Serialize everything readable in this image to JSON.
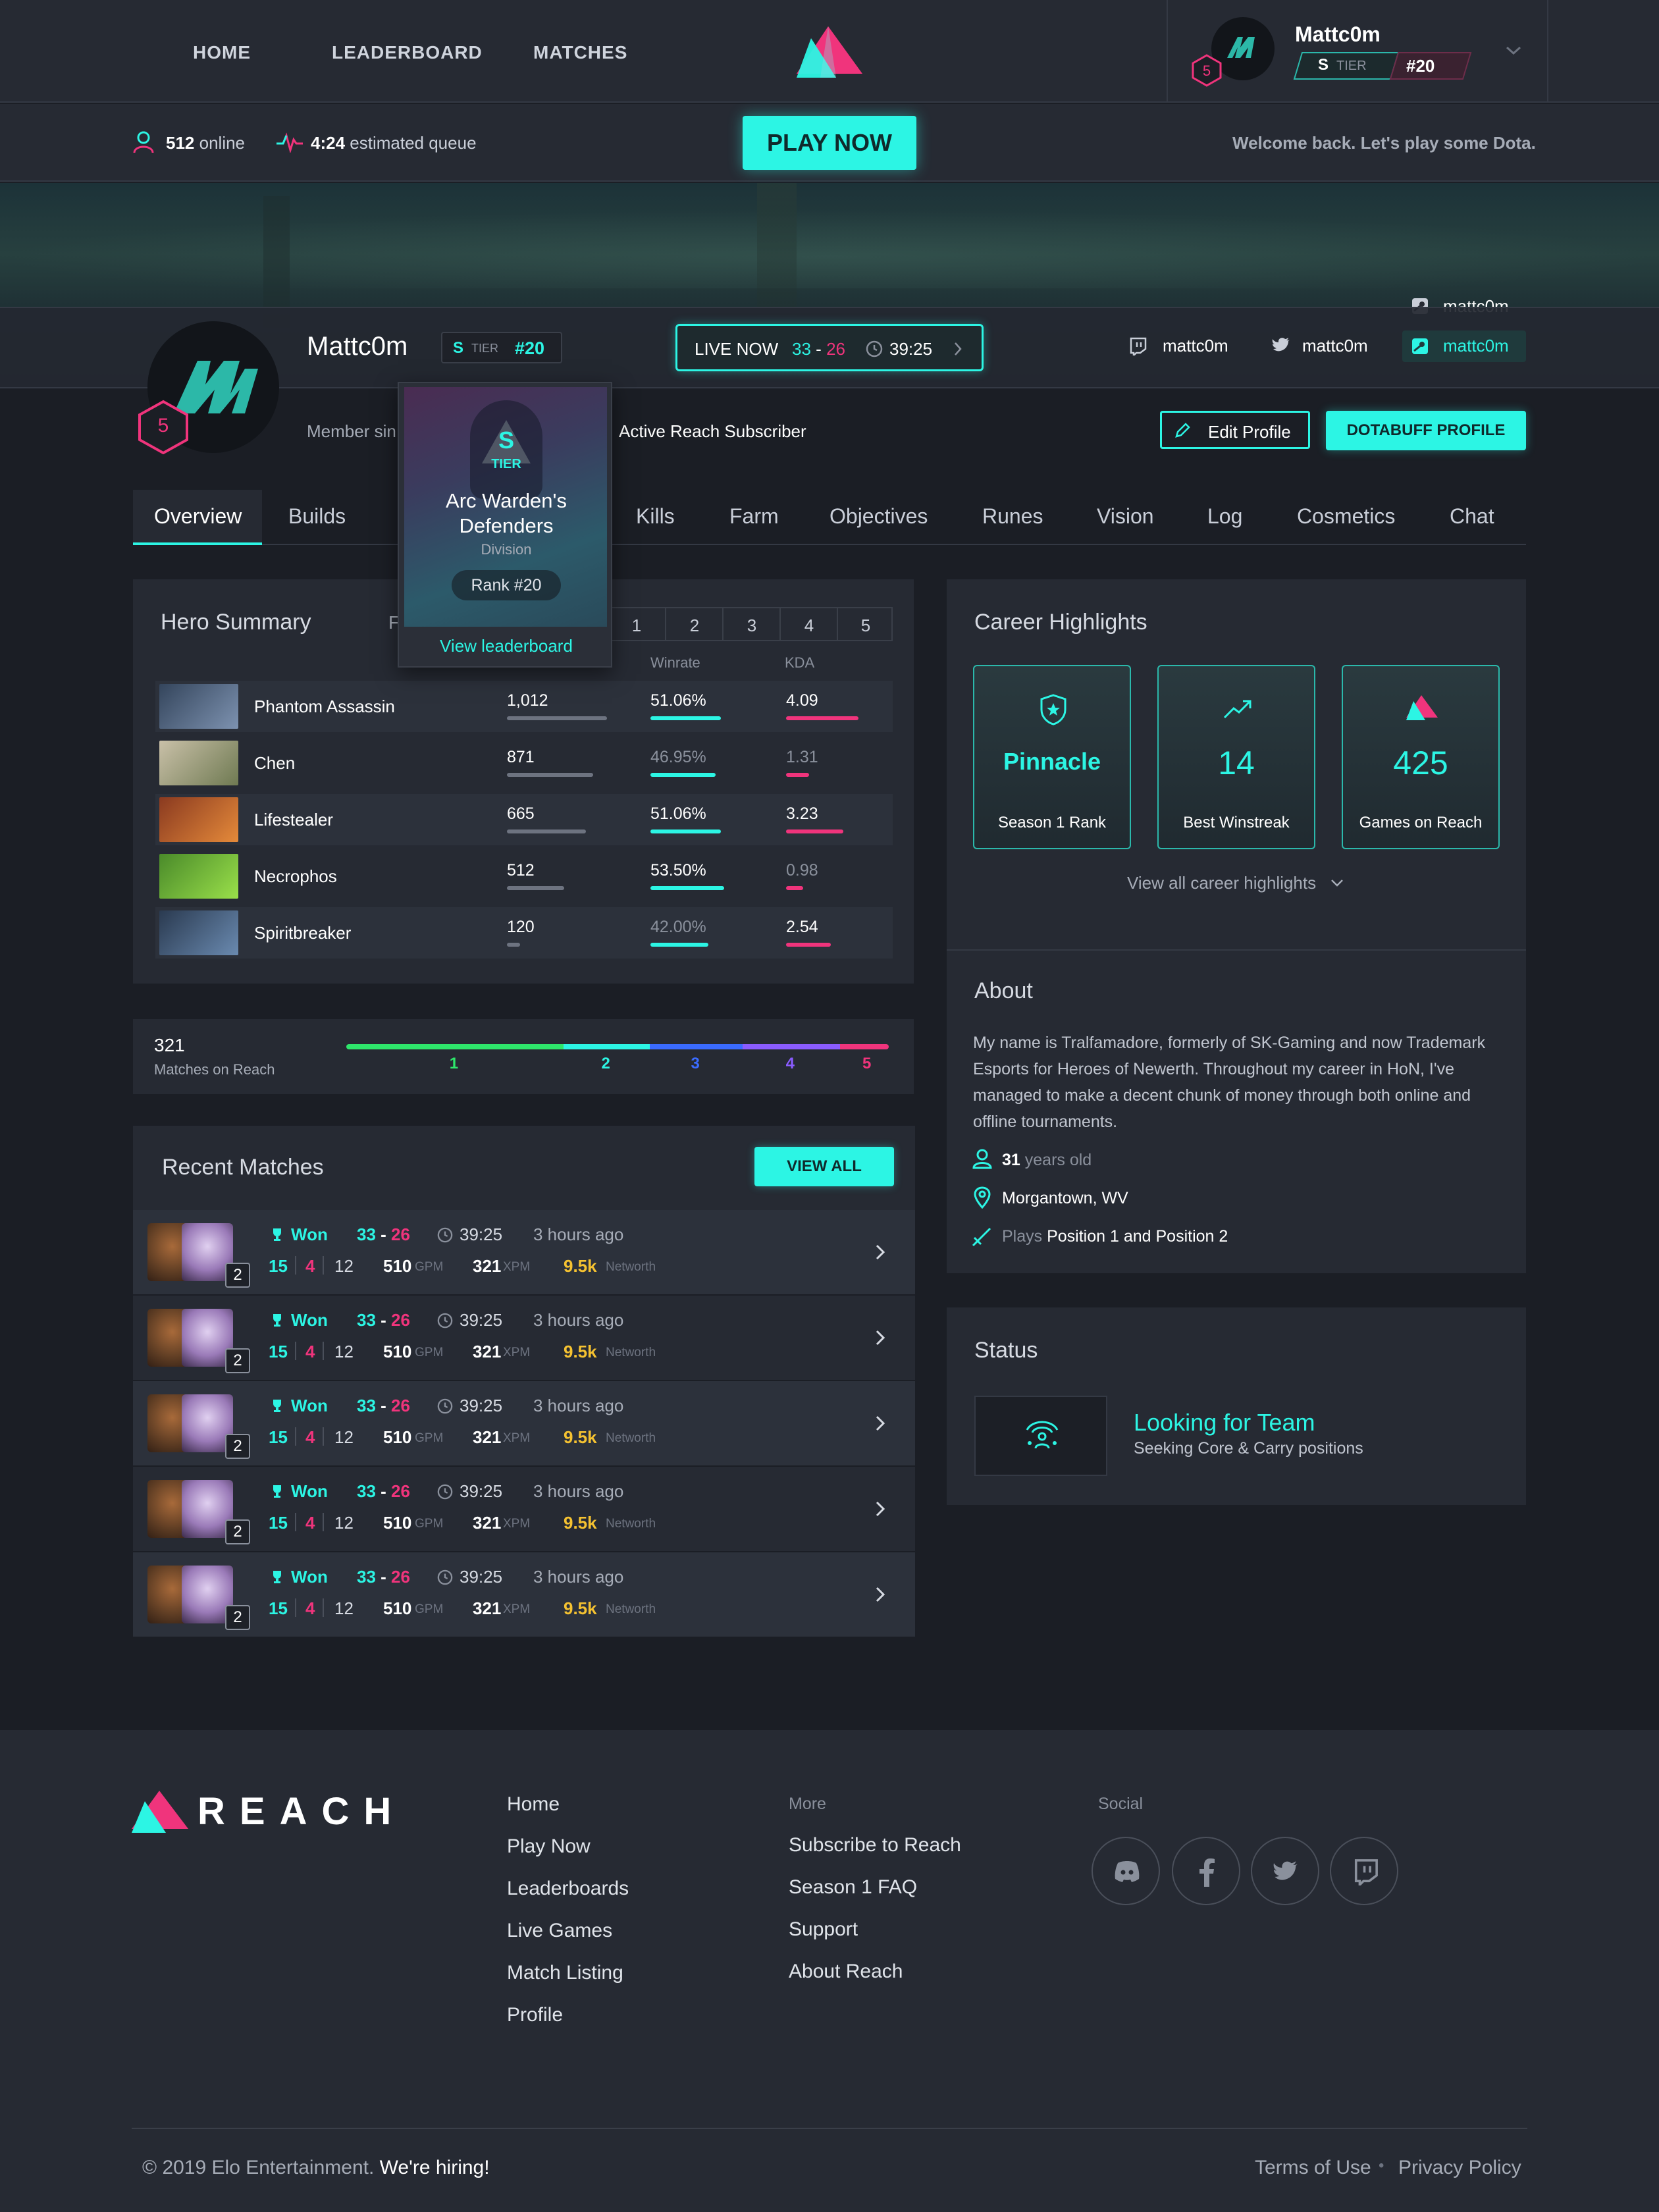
{
  "nav": {
    "home": "HOME",
    "leaderboard": "LEADERBOARD",
    "matches": "MATCHES"
  },
  "user": {
    "name": "Mattc0m",
    "tier_letter": "S",
    "tier_label": "TIER",
    "rank": "#20",
    "level": "5"
  },
  "subbar": {
    "online_count": "512",
    "online_label": "online",
    "queue_time": "4:24",
    "queue_label": "estimated queue",
    "play_now": "PLAY NOW",
    "welcome": "Welcome back. Let's play some Dota."
  },
  "profile": {
    "name": "Mattc0m",
    "tier_letter": "S",
    "tier_label": "TIER",
    "rank": "#20",
    "level": "5",
    "live": {
      "label": "LIVE NOW",
      "score_a": "33",
      "dash": "-",
      "score_b": "26",
      "time": "39:25"
    },
    "social": {
      "twitch": "mattc0m",
      "twitter": "mattc0m",
      "steam": "mattc0m",
      "steam_top": "mattc0m"
    },
    "member_since": "Member sin",
    "subscriber": "Active Reach Subscriber",
    "edit_profile": "Edit Profile",
    "dotabuff": "DOTABUFF PROFILE"
  },
  "tooltip": {
    "tier_letter": "S",
    "tier_label": "TIER",
    "team": "Arc Warden's Defenders",
    "division": "Division",
    "rank": "Rank #20",
    "link": "View leaderboard"
  },
  "tabs": [
    "Overview",
    "Builds",
    "Kills",
    "Farm",
    "Objectives",
    "Runes",
    "Vision",
    "Log",
    "Cosmetics",
    "Chat"
  ],
  "hero_summary": {
    "title": "Hero Summary",
    "filter_prefix": "F",
    "positions": [
      "1",
      "2",
      "3",
      "4",
      "5"
    ],
    "col_winrate": "Winrate",
    "col_kda": "KDA",
    "rows": [
      {
        "name": "Phantom Assassin",
        "matches": "1,012",
        "matches_frac": 1.0,
        "winrate": "51.06%",
        "win_frac": 0.51,
        "win_hi": true,
        "kda": "4.09",
        "kda_frac": 1.0,
        "kda_hi": true
      },
      {
        "name": "Chen",
        "matches": "871",
        "matches_frac": 0.86,
        "winrate": "46.95%",
        "win_frac": 0.47,
        "win_hi": false,
        "kda": "1.31",
        "kda_frac": 0.32,
        "kda_hi": false
      },
      {
        "name": "Lifestealer",
        "matches": "665",
        "matches_frac": 0.79,
        "winrate": "51.06%",
        "win_frac": 0.51,
        "win_hi": true,
        "kda": "3.23",
        "kda_frac": 0.79,
        "kda_hi": true
      },
      {
        "name": "Necrophos",
        "matches": "512",
        "matches_frac": 0.57,
        "winrate": "53.50%",
        "win_frac": 0.535,
        "win_hi": true,
        "kda": "0.98",
        "kda_frac": 0.24,
        "kda_hi": false
      },
      {
        "name": "Spiritbreaker",
        "matches": "120",
        "matches_frac": 0.13,
        "winrate": "42.00%",
        "win_frac": 0.42,
        "win_hi": false,
        "kda": "2.54",
        "kda_frac": 0.62,
        "kda_hi": true
      }
    ]
  },
  "matches_on_reach": {
    "count": "321",
    "label": "Matches on Reach",
    "positions": [
      "1",
      "2",
      "3",
      "4",
      "5"
    ],
    "position_share": [
      0.4,
      0.16,
      0.17,
      0.18,
      0.09
    ],
    "colors": [
      "#2ee66b",
      "#2cf5e4",
      "#3a6bff",
      "#8a5cff",
      "#f0347c"
    ]
  },
  "recent_matches": {
    "title": "Recent Matches",
    "view_all": "VIEW ALL",
    "rows": [
      {
        "badge": "2",
        "result": "Won",
        "score_a": "33",
        "score_b": "26",
        "time": "39:25",
        "ago": "3 hours ago",
        "k": "15",
        "d": "4",
        "a": "12",
        "gpm": "510",
        "gpm_label": "GPM",
        "xpm": "321",
        "xpm_label": "XPM",
        "networth": "9.5k",
        "networth_label": "Networth"
      },
      {
        "badge": "2",
        "result": "Won",
        "score_a": "33",
        "score_b": "26",
        "time": "39:25",
        "ago": "3 hours ago",
        "k": "15",
        "d": "4",
        "a": "12",
        "gpm": "510",
        "gpm_label": "GPM",
        "xpm": "321",
        "xpm_label": "XPM",
        "networth": "9.5k",
        "networth_label": "Networth"
      },
      {
        "badge": "2",
        "result": "Won",
        "score_a": "33",
        "score_b": "26",
        "time": "39:25",
        "ago": "3 hours ago",
        "k": "15",
        "d": "4",
        "a": "12",
        "gpm": "510",
        "gpm_label": "GPM",
        "xpm": "321",
        "xpm_label": "XPM",
        "networth": "9.5k",
        "networth_label": "Networth"
      },
      {
        "badge": "2",
        "result": "Won",
        "score_a": "33",
        "score_b": "26",
        "time": "39:25",
        "ago": "3 hours ago",
        "k": "15",
        "d": "4",
        "a": "12",
        "gpm": "510",
        "gpm_label": "GPM",
        "xpm": "321",
        "xpm_label": "XPM",
        "networth": "9.5k",
        "networth_label": "Networth"
      },
      {
        "badge": "2",
        "result": "Won",
        "score_a": "33",
        "score_b": "26",
        "time": "39:25",
        "ago": "3 hours ago",
        "k": "15",
        "d": "4",
        "a": "12",
        "gpm": "510",
        "gpm_label": "GPM",
        "xpm": "321",
        "xpm_label": "XPM",
        "networth": "9.5k",
        "networth_label": "Networth"
      }
    ]
  },
  "career": {
    "title": "Career Highlights",
    "cards": [
      {
        "value": "Pinnacle",
        "label": "Season 1 Rank",
        "icon": "shield-star-icon"
      },
      {
        "value": "14",
        "label": "Best Winstreak",
        "icon": "trend-up-icon"
      },
      {
        "value": "425",
        "label": "Games on Reach",
        "icon": "reach-logo-icon"
      }
    ],
    "view_all": "View all career highlights"
  },
  "about": {
    "title": "About",
    "bio": "My name is Tralfamadore, formerly of SK-Gaming and now Trademark Esports for Heroes of Newerth. Throughout my career in HoN, I've managed to make a decent chunk of money through both online and offline tournaments.",
    "age": "31",
    "age_label": "years old",
    "location": "Morgantown, WV",
    "plays_prefix": "Plays",
    "plays": "Position 1 and Position 2"
  },
  "status": {
    "title": "Status",
    "headline": "Looking for Team",
    "detail": "Seeking Core & Carry positions"
  },
  "footer": {
    "brand": "REACH",
    "col1": [
      "Home",
      "Play Now",
      "Leaderboards",
      "Live Games",
      "Match Listing",
      "Profile"
    ],
    "more_title": "More",
    "col2": [
      "Subscribe to Reach",
      "Season 1 FAQ",
      "Support",
      "About Reach"
    ],
    "social_title": "Social",
    "social_icons": [
      "discord-icon",
      "facebook-icon",
      "twitter-icon",
      "twitch-icon"
    ],
    "copyright": "© 2019 Elo Entertainment.",
    "hiring": "We're hiring!",
    "terms": "Terms of Use",
    "sep": "•",
    "privacy": "Privacy Policy"
  },
  "colors": {
    "accent": "#2cf5e4",
    "pink": "#f0347c",
    "yellow": "#f5c231",
    "bg": "#1b1e25",
    "panel": "#262a33"
  }
}
